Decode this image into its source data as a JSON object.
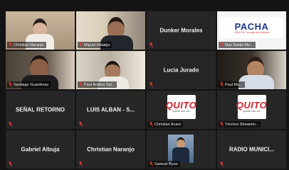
{
  "tiles": [
    {
      "name": "Christian Naranjo",
      "kind": "video"
    },
    {
      "name": "Miguel Hidalgo",
      "kind": "video"
    },
    {
      "name": "Dunker Morales",
      "kind": "text"
    },
    {
      "name": "Mac Radio Mu...",
      "kind": "logo",
      "logo": "PACHA",
      "logo_sub": "103.8 FM · la radio de la ciudad"
    },
    {
      "name": "Santiago Guarderas",
      "kind": "video"
    },
    {
      "name": "Paul Andino Sal...",
      "kind": "video"
    },
    {
      "name": "Lucia Jurado",
      "kind": "text"
    },
    {
      "name": "Paul Mu...",
      "kind": "video"
    },
    {
      "name": "SEÑAL RETORNO",
      "kind": "text"
    },
    {
      "name": "LUIS ALBAN - S...",
      "kind": "text"
    },
    {
      "name": "Christian Acaro",
      "kind": "logo",
      "logo": "QUITO",
      "logo_sub": "grande otra vez"
    },
    {
      "name": "Técnico Streamin...",
      "kind": "logo",
      "logo": "QUITO",
      "logo_sub": "grande otra vez"
    },
    {
      "name": "Gabriel Albuja",
      "kind": "text"
    },
    {
      "name": "Christian Naranjo",
      "kind": "text"
    },
    {
      "name": "Samuel Byun",
      "kind": "video"
    },
    {
      "name": "RADIO MUNICI...",
      "kind": "text"
    }
  ],
  "colors": {
    "background": "#141414",
    "tile": "#262626",
    "muted_icon": "#e53935"
  }
}
